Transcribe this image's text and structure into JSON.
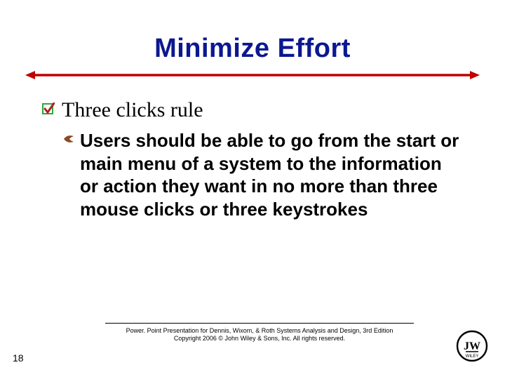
{
  "title": "Minimize Effort",
  "bullets": {
    "level1": "Three clicks rule",
    "level2": "Users should be able to go from the start or main menu of a system to the information or action they want in no more than three mouse clicks or three keystrokes"
  },
  "footer": {
    "line1": "Power. Point Presentation for Dennis, Wixom, & Roth Systems Analysis and Design, 3rd Edition",
    "line2": "Copyright 2006 © John Wiley & Sons, Inc.  All rights reserved."
  },
  "page_number": "18",
  "colors": {
    "title_blue": "#0b1890",
    "rule_red": "#c00000",
    "check_green": "#2aa838",
    "check_red": "#b02020",
    "leaf_brown": "#8a4a28"
  }
}
